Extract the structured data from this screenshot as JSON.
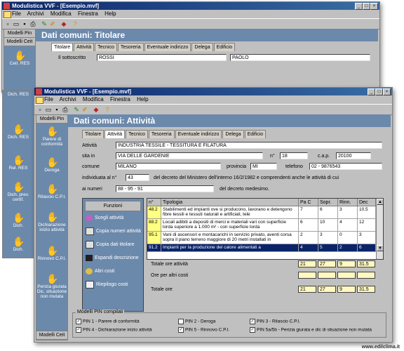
{
  "back_window": {
    "title": "Modulistica VVF - [Esempio.mvf]",
    "menu": [
      "File",
      "Archivi",
      "Modifica",
      "Finestra",
      "Help"
    ],
    "sidebar_head_1": "Modelli Pin",
    "sidebar_head_2": "Modelli Ceit",
    "side_items": [
      "Ceit. RES",
      "Dich. RES",
      "Dich. RES",
      "Rel. RES",
      "Dich. prev. certif.",
      "Dich.",
      "Dich."
    ],
    "panel_title": "Dati comuni: Titolare",
    "tabs": [
      "Titolare",
      "Attività",
      "Tecnico",
      "Tesoreria",
      "Eventuale indirizzo",
      "Delega",
      "Edificio"
    ],
    "sottoscritto_label": "Il sottoscritto",
    "cognome": "ROSSI",
    "nome": "PAOLO"
  },
  "front_window": {
    "title": "Modulistica VVF - [Esempio.mvf]",
    "menu": [
      "File",
      "Archivi",
      "Modifica",
      "Finestra",
      "Help"
    ],
    "sidebar_head": "Modelli Pin",
    "sidebar_foot": "Modelli Ceit",
    "side_items": [
      {
        "label": "Parere di conformità",
        "icon": "hand-form-icon"
      },
      {
        "label": "Deroga",
        "icon": "hand-form-icon"
      },
      {
        "label": "Rilascio C.P.I.",
        "icon": "hand-form-icon"
      },
      {
        "label": "Dichiarazione inizio attività",
        "icon": "hand-form-icon"
      },
      {
        "label": "Rinnovo C.P.I.",
        "icon": "hand-form-icon"
      },
      {
        "label": "Perizia giurata Dic. situazione non mutata",
        "icon": "hand-form-icon"
      }
    ],
    "panel_title": "Dati comuni: Attività",
    "tabs": [
      "Titolare",
      "Attività",
      "Tecnico",
      "Tesoreria",
      "Eventuale indirizzo",
      "Delega",
      "Edificio"
    ],
    "active_tab": "Attività",
    "form": {
      "attivita_label": "Attività",
      "attivita_value": "INDUSTRIA TESSILE - TESSITURA E FILATURA",
      "sita_in_label": "sita in",
      "sita_in_value": "VIA DELLE GARDENIE",
      "n_label": "n°",
      "n_value": "18",
      "cap_label": "c.a.p.",
      "cap_value": "20100",
      "comune_label": "comune",
      "comune_value": "MILANO",
      "provincia_label": "provincia",
      "provincia_value": "MI",
      "telefono_label": "telefono",
      "telefono_value": "02 - 9876543",
      "individuata_label": "individuata al n°",
      "individuata_value": "43",
      "individuata_text": "del decreto del Ministero dell'interno 16/2/1982 e comprendenti anche le attività di cui",
      "numeri_label": "ai numeri",
      "numeri_value": "88 - 95 - 91",
      "numeri_text": "del decreto medesimo."
    },
    "functions": {
      "head": "Funzioni",
      "items": [
        {
          "label": "Scegli attività",
          "icon": "choose-icon"
        },
        {
          "label": "Copia numeri attività",
          "icon": "copy-icon"
        },
        {
          "label": "Copia dati titolare",
          "icon": "copy-icon"
        },
        {
          "label": "Espandi descrizione",
          "icon": "expand-icon"
        },
        {
          "label": "Altri costi",
          "icon": "coins-icon"
        },
        {
          "label": "Riepilogo costi",
          "icon": "summary-icon"
        }
      ]
    },
    "grid": {
      "headers": [
        "n°",
        "Tipologia",
        "Pa C",
        "Sopr.",
        "Rinn.",
        "Dec"
      ],
      "rows": [
        {
          "n": "48.2",
          "tipologia": "Stabilimenti ed impianti ove si producono, lavorano e detengono fibre tessili e tessuti naturali e artificiali, tele",
          "pac": "7",
          "sopr": "6",
          "rinn": "3",
          "dec": "10.5"
        },
        {
          "n": "88.2",
          "tipologia": "Locali adibiti a depositi di merci e materiali vari con superficie lorda superiore a 1.000 m² - con superficie lorda",
          "pac": "6",
          "sopr": "10",
          "rinn": "4",
          "dec": "12"
        },
        {
          "n": "95.1",
          "tipologia": "Vani di ascensori e montacarichi in servizio privato, aventi corsa sopra il piano terreno maggiore di 20 metri installati in",
          "pac": "2",
          "sopr": "3",
          "rinn": "0",
          "dec": "3"
        },
        {
          "n": "91.2",
          "tipologia": "Impianti per la produzione del calore alimentati a",
          "pac": "4",
          "sopr": "5",
          "rinn": "2",
          "dec": "6"
        }
      ]
    },
    "totals": {
      "totale_attivita_label": "Totale ore attività",
      "totale_attivita": [
        "21",
        "27",
        "9",
        "31.5"
      ],
      "altri_costi_label": "Ore per altri costi",
      "totale_label": "Totale ore",
      "totale": [
        "21",
        "27",
        "9",
        "31.5"
      ]
    },
    "pin": {
      "legend": "Modelli PIN compilati",
      "items": [
        {
          "label": "PIN 1 - Parere di conformità",
          "checked": true
        },
        {
          "label": "PIN 2 - Deroga",
          "checked": false
        },
        {
          "label": "PIN 3 - Rilascio C.P.I.",
          "checked": true
        },
        {
          "label": "PIN 4 - Dichiarazione inizio attività",
          "checked": true
        },
        {
          "label": "PIN 5 - Rinnovo C.P.I.",
          "checked": true
        },
        {
          "label": "PIN 5a/5b - Perizia giurata e dic di situazione non mutata",
          "checked": true
        }
      ]
    }
  },
  "footer_url": "www.edilclima.it",
  "colors": {
    "panel": "#6b89ab",
    "title_bar": "#0a246a",
    "highlight_row": "#ffff80",
    "selected_row": "#0a246a"
  }
}
